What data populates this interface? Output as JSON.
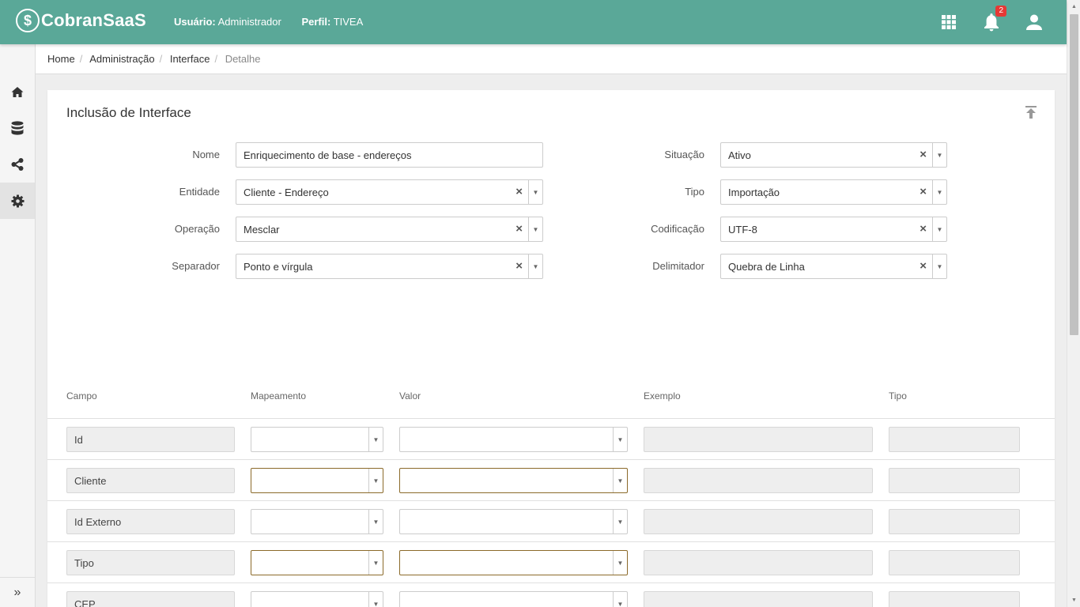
{
  "app": {
    "logo_text": "CobranSaaS",
    "logo_mark": "$",
    "user_label": "Usuário:",
    "user_value": "Administrador",
    "profile_label": "Perfil:",
    "profile_value": "TIVEA",
    "notification_count": "2",
    "accent_color": "#5aa898"
  },
  "breadcrumb": {
    "items": [
      "Home",
      "Administração",
      "Interface"
    ],
    "current": "Detalhe"
  },
  "form": {
    "title": "Inclusão de Interface",
    "nome_label": "Nome",
    "nome_value": "Enriquecimento de base - endereços",
    "entidade_label": "Entidade",
    "entidade_value": "Cliente - Endereço",
    "operacao_label": "Operação",
    "operacao_value": "Mesclar",
    "separador_label": "Separador",
    "separador_value": "Ponto e vírgula",
    "situacao_label": "Situação",
    "situacao_value": "Ativo",
    "tipo_label": "Tipo",
    "tipo_value": "Importação",
    "codificacao_label": "Codificação",
    "codificacao_value": "UTF-8",
    "delimitador_label": "Delimitador",
    "delimitador_value": "Quebra de Linha",
    "clear_glyph": "×",
    "arrow_glyph": "▼"
  },
  "table": {
    "headers": [
      "Campo",
      "Mapeamento",
      "Valor",
      "Exemplo",
      "Tipo"
    ],
    "rows": [
      {
        "campo": "Id",
        "required": false
      },
      {
        "campo": "Cliente",
        "required": true
      },
      {
        "campo": "Id Externo",
        "required": false
      },
      {
        "campo": "Tipo",
        "required": true
      },
      {
        "campo": "CEP",
        "required": false
      }
    ]
  },
  "sidebar": {
    "icons": [
      "home-icon",
      "database-icon",
      "share-icon",
      "gear-icon"
    ],
    "expand_glyph": "»"
  }
}
